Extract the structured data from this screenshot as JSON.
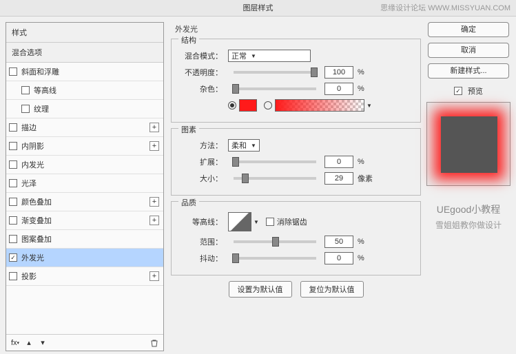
{
  "watermark": "思缘设计论坛  WWW.MISSYUAN.COM",
  "title": "图层样式",
  "sidebar": {
    "header": "样式",
    "blend": "混合选项",
    "items": [
      {
        "label": "斜面和浮雕",
        "plus": false,
        "indent": false
      },
      {
        "label": "等高线",
        "plus": false,
        "indent": true
      },
      {
        "label": "纹理",
        "plus": false,
        "indent": true
      },
      {
        "label": "描边",
        "plus": true,
        "indent": false
      },
      {
        "label": "内阴影",
        "plus": true,
        "indent": false
      },
      {
        "label": "内发光",
        "plus": false,
        "indent": false
      },
      {
        "label": "光泽",
        "plus": false,
        "indent": false
      },
      {
        "label": "颜色叠加",
        "plus": true,
        "indent": false
      },
      {
        "label": "渐变叠加",
        "plus": true,
        "indent": false
      },
      {
        "label": "图案叠加",
        "plus": false,
        "indent": false
      },
      {
        "label": "外发光",
        "plus": false,
        "indent": false,
        "checked": true,
        "selected": true
      },
      {
        "label": "投影",
        "plus": true,
        "indent": false
      }
    ]
  },
  "panel": {
    "title": "外发光",
    "g1": {
      "title": "结构",
      "blend_label": "混合模式：",
      "blend_value": "正常",
      "opacity_label": "不透明度：",
      "opacity": "100",
      "pct": "%",
      "noise_label": "杂色：",
      "noise": "0"
    },
    "g2": {
      "title": "图素",
      "method_label": "方法：",
      "method_value": "柔和",
      "spread_label": "扩展：",
      "spread": "0",
      "size_label": "大小：",
      "size": "29",
      "px": "像素"
    },
    "g3": {
      "title": "品质",
      "contour_label": "等高线：",
      "aa": "消除锯齿",
      "range_label": "范围：",
      "range": "50",
      "jitter_label": "抖动：",
      "jitter": "0"
    },
    "btn_default": "设置为默认值",
    "btn_reset": "复位为默认值"
  },
  "right": {
    "ok": "确定",
    "cancel": "取消",
    "new": "新建样式...",
    "preview": "预览",
    "credit1": "UEgood小教程",
    "credit2": "雪姐姐教你做设计"
  }
}
